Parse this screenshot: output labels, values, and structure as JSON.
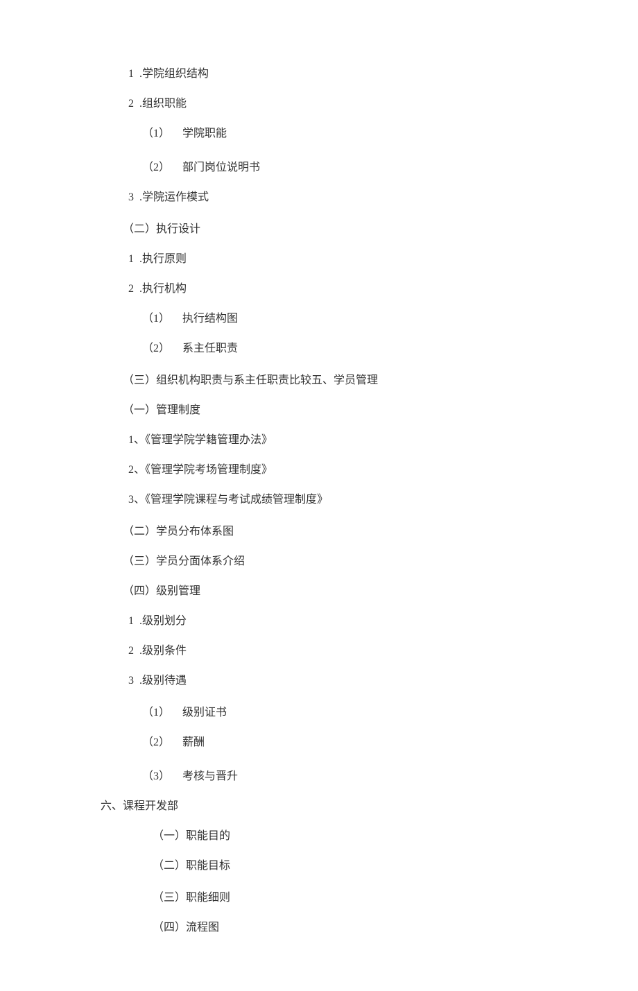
{
  "lines": {
    "l1_num": "1",
    "l1_text": ".学院组织结构",
    "l2_num": "2",
    "l2_text": ".组织职能",
    "l3_paren": "（1）",
    "l3_text": "学院职能",
    "l4_paren": "（2）",
    "l4_text": "部门岗位说明书",
    "l5_num": "3",
    "l5_text": ".学院运作模式",
    "l6_text": "（二）执行设计",
    "l7_num": "1",
    "l7_text": ".执行原则",
    "l8_num": "2",
    "l8_text": ".执行机构",
    "l9_paren": "（1）",
    "l9_text": "执行结构图",
    "l10_paren": "（2）",
    "l10_text": "系主任职责",
    "l11_text": "（三）组织机构职责与系主任职责比较五、学员管理",
    "l12_text": "（一）管理制度",
    "l13_text": "1、《管理学院学籍管理办法》",
    "l14_text": "2、《管理学院考场管理制度》",
    "l15_text": "3、《管理学院课程与考试成绩管理制度》",
    "l16_text": "（二）学员分布体系图",
    "l17_text": "（三）学员分面体系介绍",
    "l18_text": "（四）级别管理",
    "l19_num": "1",
    "l19_text": ".级别划分",
    "l20_num": "2",
    "l20_text": ".级别条件",
    "l21_num": "3",
    "l21_text": ".级别待遇",
    "l22_paren": "（1）",
    "l22_text": "级别证书",
    "l23_paren": "（2）",
    "l23_text": "薪酬",
    "l24_paren": "（3）",
    "l24_text": "考核与晋升",
    "l25_text": "六、课程开发部",
    "l26_text": "（一）职能目的",
    "l27_text": "（二）职能目标",
    "l28_text": "（三）职能细则",
    "l29_text": "（四）流程图"
  }
}
